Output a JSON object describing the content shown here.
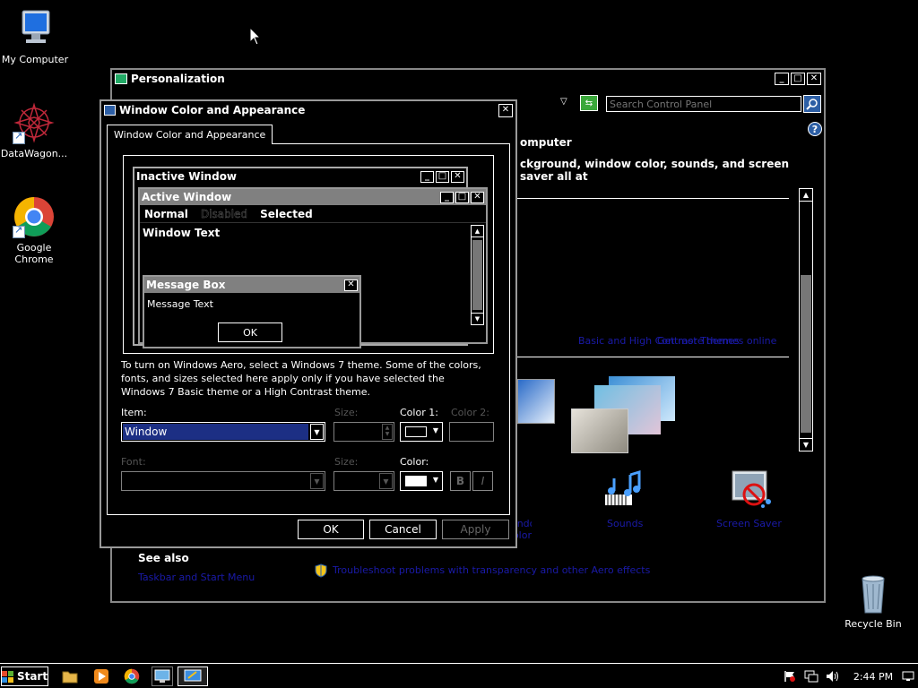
{
  "desktop": {
    "icons": [
      {
        "label": "My Computer",
        "icon": "computer-icon"
      },
      {
        "label": "DataWagon...",
        "icon": "datawagon-icon"
      },
      {
        "label": "Google Chrome",
        "icon": "chrome-icon"
      },
      {
        "label": "Recycle Bin",
        "icon": "recycle-bin-icon"
      }
    ]
  },
  "personalization": {
    "title": "Personalization",
    "search_placeholder": "Search Control Panel",
    "heading_fragment": "omputer",
    "subheading_fragment": "ckground, window color, sounds, and screen saver all at",
    "links": [
      "Basic and High Contrast Themes",
      "Get more themes online"
    ],
    "bottom_items": [
      "Window Color",
      "Sounds",
      "Screen Saver"
    ],
    "see_also_title": "See also",
    "see_also_links": [
      "Taskbar and Start Menu",
      "Troubleshoot problems with transparency and other Aero effects"
    ]
  },
  "dialog": {
    "title": "Window Color and Appearance",
    "tab": "Window Color and Appearance",
    "preview": {
      "inactive_title": "Inactive Window",
      "active_title": "Active Window",
      "menu": [
        "Normal",
        "Disabled",
        "Selected"
      ],
      "window_text": "Window Text",
      "msgbox_title": "Message Box",
      "msgbox_text": "Message Text",
      "msgbox_ok": "OK"
    },
    "info": "To turn on Windows Aero, select a Windows 7 theme.  Some of the colors, fonts, and sizes selected here apply only if you have selected the Windows 7 Basic theme or a High Contrast theme.",
    "item_label": "Item:",
    "item_value": "Window",
    "size1_label": "Size:",
    "color1_label": "Color 1:",
    "color2_label": "Color 2:",
    "font_label": "Font:",
    "size2_label": "Size:",
    "color_label": "Color:",
    "bold_label": "B",
    "italic_label": "I",
    "ok": "OK",
    "cancel": "Cancel",
    "apply": "Apply"
  },
  "taskbar": {
    "start": "Start",
    "time": "2:44 PM"
  },
  "colors": {
    "selection": "#1c2f84",
    "link": "#1a1aa8",
    "window_border": "#808080"
  }
}
